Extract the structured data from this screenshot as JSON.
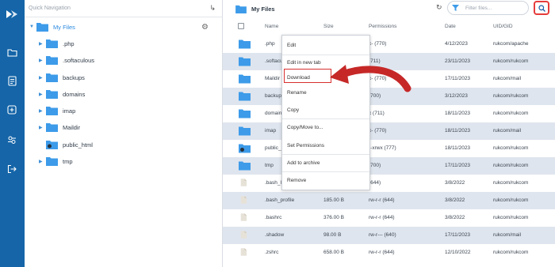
{
  "sidebar": {
    "quick_nav_label": "Quick Navigation",
    "root_label": "My Files",
    "items": [
      {
        "label": ".php"
      },
      {
        "label": ".softaculous"
      },
      {
        "label": "backups"
      },
      {
        "label": "domains"
      },
      {
        "label": "imap"
      },
      {
        "label": "Maildir"
      },
      {
        "label": "public_html"
      },
      {
        "label": "tmp"
      }
    ]
  },
  "header": {
    "title": "My Files",
    "filter_placeholder": "Filter files..."
  },
  "table": {
    "columns": [
      "Name",
      "Size",
      "Permissions",
      "Date",
      "UID/GID"
    ],
    "rows": [
      {
        "name": ".php",
        "size": "",
        "perms": "x- (770)",
        "date": "4/12/2023",
        "owner": "rukcom/apache",
        "type": "folder"
      },
      {
        "name": ".softacu",
        "size": "",
        "perms": "(711)",
        "date": "23/11/2023",
        "owner": "rukcom/rukcom",
        "type": "folder"
      },
      {
        "name": "Maildir",
        "size": "",
        "perms": "x- (770)",
        "date": "17/11/2023",
        "owner": "rukcom/mail",
        "type": "folder"
      },
      {
        "name": "backup",
        "size": "",
        "perms": "(700)",
        "date": "3/12/2023",
        "owner": "rukcom/rukcom",
        "type": "folder"
      },
      {
        "name": "domain",
        "size": "",
        "perms": "x (711)",
        "date": "18/11/2023",
        "owner": "rukcom/rukcom",
        "type": "folder"
      },
      {
        "name": "imap",
        "size": "",
        "perms": "x- (770)",
        "date": "18/11/2023",
        "owner": "rukcom/mail",
        "type": "folder"
      },
      {
        "name": "public_",
        "size": "",
        "perms": "r-xrwx (777)",
        "date": "18/11/2023",
        "owner": "rukcom/rukcom",
        "type": "folder-globe"
      },
      {
        "name": "tmp",
        "size": "",
        "perms": "(700)",
        "date": "17/11/2023",
        "owner": "rukcom/rukcom",
        "type": "folder"
      },
      {
        "name": ".bash_l",
        "size": "",
        "perms": "(644)",
        "date": "3/8/2022",
        "owner": "rukcom/rukcom",
        "type": "file"
      },
      {
        "name": ".bash_profile",
        "size": "185.00 B",
        "perms": "rw-r-r (644)",
        "date": "3/8/2022",
        "owner": "rukcom/rukcom",
        "type": "file"
      },
      {
        "name": ".bashrc",
        "size": "376.00 B",
        "perms": "rw-r-r (644)",
        "date": "3/8/2022",
        "owner": "rukcom/rukcom",
        "type": "file"
      },
      {
        "name": ".shadow",
        "size": "98.00 B",
        "perms": "rw-r--- (640)",
        "date": "17/11/2023",
        "owner": "rukcom/mail",
        "type": "file"
      },
      {
        "name": ".zshrc",
        "size": "658.00 B",
        "perms": "rw-r-r (644)",
        "date": "12/10/2022",
        "owner": "rukcom/rukcom",
        "type": "file"
      }
    ]
  },
  "context_menu": {
    "edit": "Edit",
    "edit_new_tab": "Edit in new tab",
    "download": "Download",
    "rename": "Rename",
    "copy": "Copy",
    "copy_move": "Copy/Move to...",
    "set_permissions": "Set Permissions",
    "add_archive": "Add to archive",
    "remove": "Remove"
  },
  "colors": {
    "rail": "#1565a8",
    "folder": "#3d9be9",
    "highlight": "#d82f2f",
    "row_alt": "#dfe5ee"
  },
  "icons": {
    "logo": "brand-arrow-icon",
    "rail": [
      "folder-icon",
      "document-icon",
      "plus-square-icon",
      "settings-icon",
      "logout-icon"
    ]
  }
}
